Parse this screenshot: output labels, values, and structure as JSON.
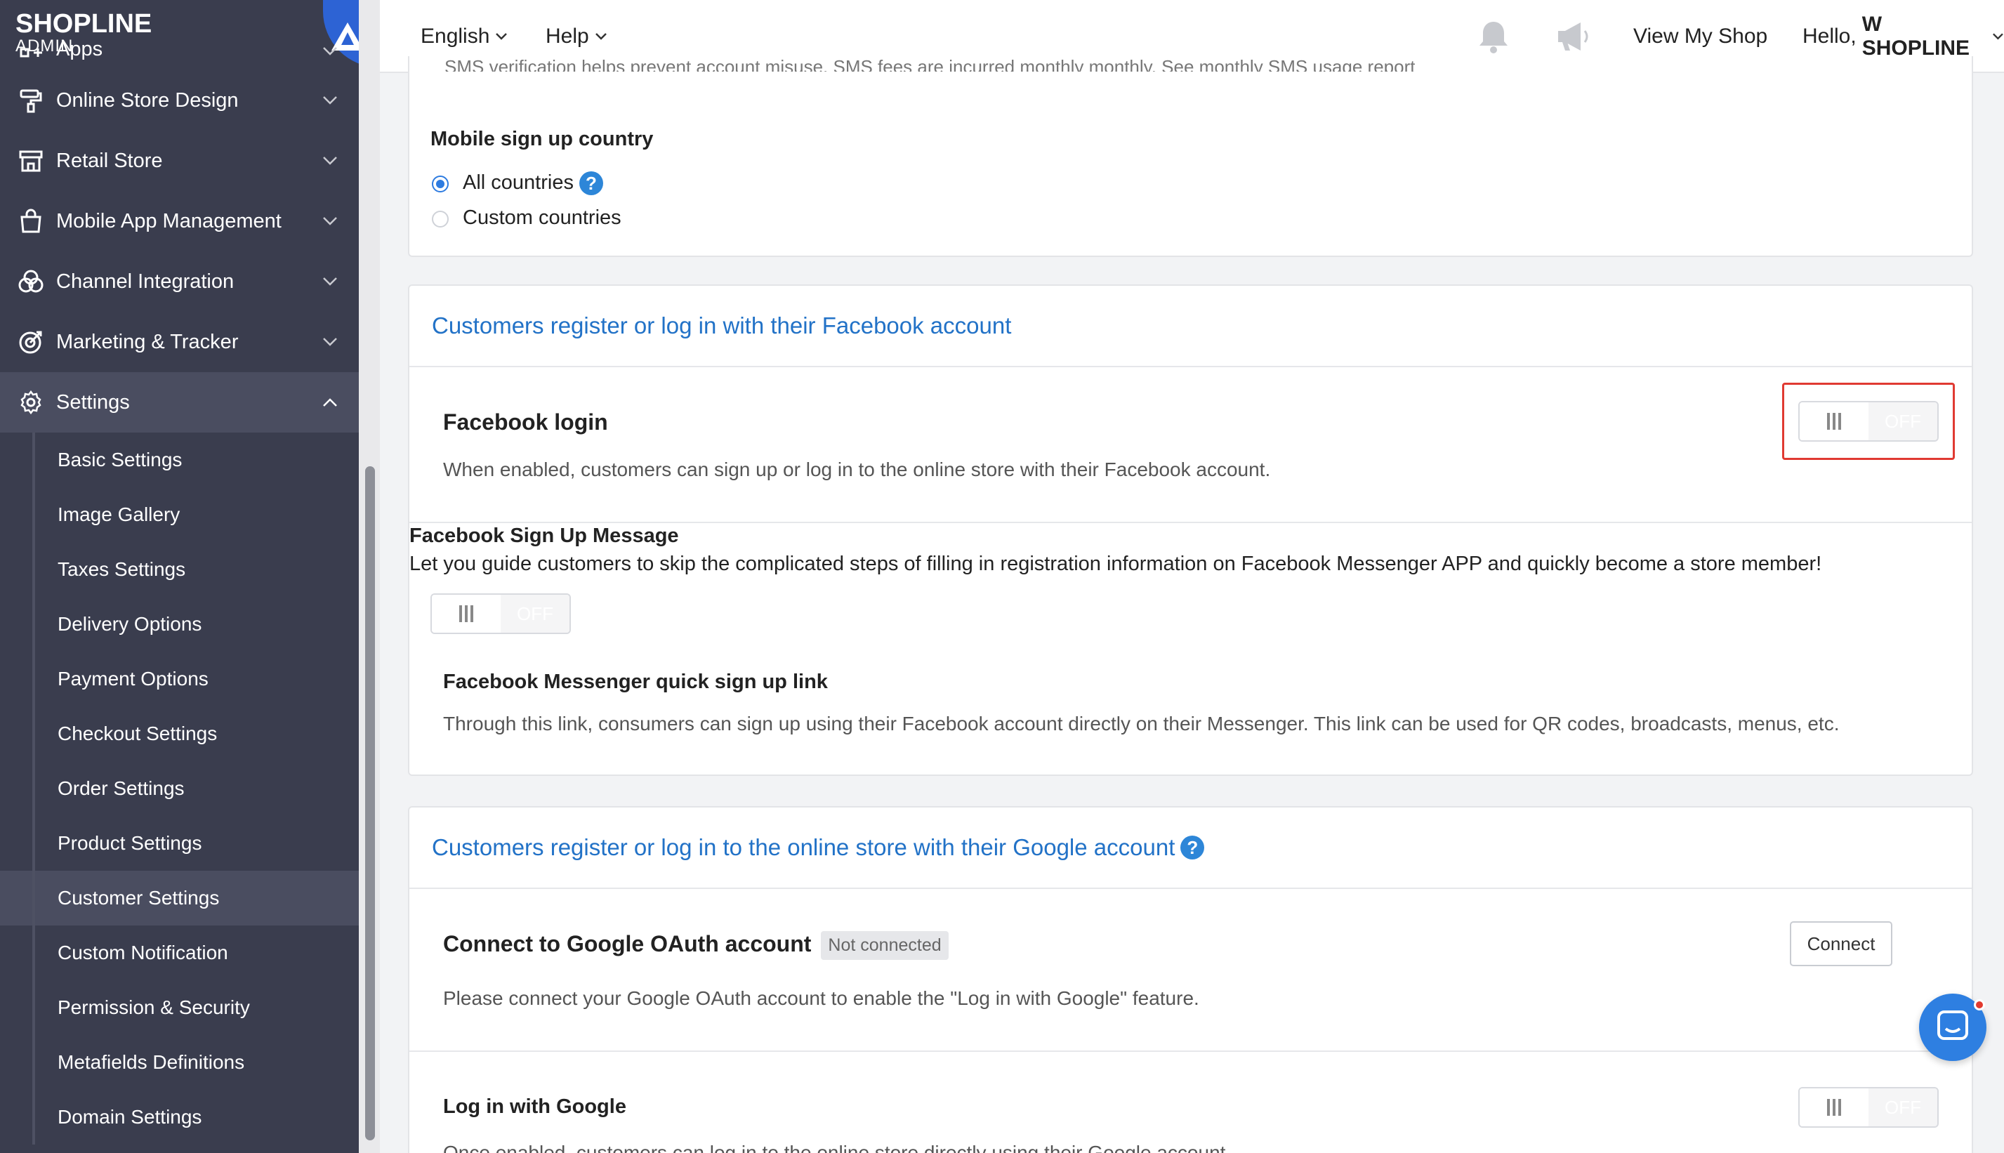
{
  "sidebar": {
    "logo_main": "SHOPLINE",
    "logo_sub": "ADMIN",
    "items": [
      {
        "label": "Apps",
        "icon": "apps-icon"
      },
      {
        "label": "Online Store Design",
        "icon": "paint-roller-icon"
      },
      {
        "label": "Retail Store",
        "icon": "store-icon"
      },
      {
        "label": "Mobile App Management",
        "icon": "shopping-bag-icon"
      },
      {
        "label": "Channel Integration",
        "icon": "venn-icon"
      },
      {
        "label": "Marketing & Tracker",
        "icon": "target-icon"
      },
      {
        "label": "Settings",
        "icon": "gear-icon"
      }
    ],
    "sub_items": [
      "Basic Settings",
      "Image Gallery",
      "Taxes Settings",
      "Delivery Options",
      "Payment Options",
      "Checkout Settings",
      "Order Settings",
      "Product Settings",
      "Customer Settings",
      "Custom Notification",
      "Permission & Security",
      "Metafields Definitions",
      "Domain Settings"
    ],
    "active_sub_item": "Customer Settings"
  },
  "topbar": {
    "language": "English",
    "help": "Help",
    "view_shop": "View My Shop",
    "greeting": "Hello,",
    "user": "W SHOPLINE"
  },
  "sms_card": {
    "cut_text": "SMS verification helps prevent account misuse. SMS fees are incurred monthly monthly. See monthly SMS usage report",
    "country_title": "Mobile sign up country",
    "option_all": "All countries",
    "option_custom": "Custom countries",
    "selected": "All countries"
  },
  "facebook_card": {
    "header": "Customers register or log in with their Facebook account",
    "login_title": "Facebook login",
    "login_desc": "When enabled, customers can sign up or log in to the online store with their Facebook account.",
    "login_toggle": "OFF",
    "signup_msg_title": "Facebook Sign Up Message",
    "signup_msg_desc": "Let you guide customers to skip the complicated steps of filling in registration information on Facebook Messenger APP and quickly become a store member!",
    "signup_toggle": "OFF",
    "messenger_title": "Facebook Messenger quick sign up link",
    "messenger_desc": "Through this link, consumers can sign up using their Facebook account directly on their Messenger. This link can be used for QR codes, broadcasts, menus, etc."
  },
  "google_card": {
    "header": "Customers register or log in to the online store with their Google account",
    "oauth_title": "Connect to Google OAuth account",
    "oauth_badge": "Not connected",
    "oauth_desc": "Please connect your Google OAuth account to enable the \"Log in with Google\" feature.",
    "connect_button": "Connect",
    "google_login_title": "Log in with Google",
    "google_login_toggle": "OFF",
    "google_login_desc": "Once enabled, customers can log in to the online store directly using their Google account."
  },
  "colors": {
    "sidebar_bg": "#3a3d4e",
    "accent_blue": "#2272c7",
    "highlight_red": "#e03a32"
  }
}
